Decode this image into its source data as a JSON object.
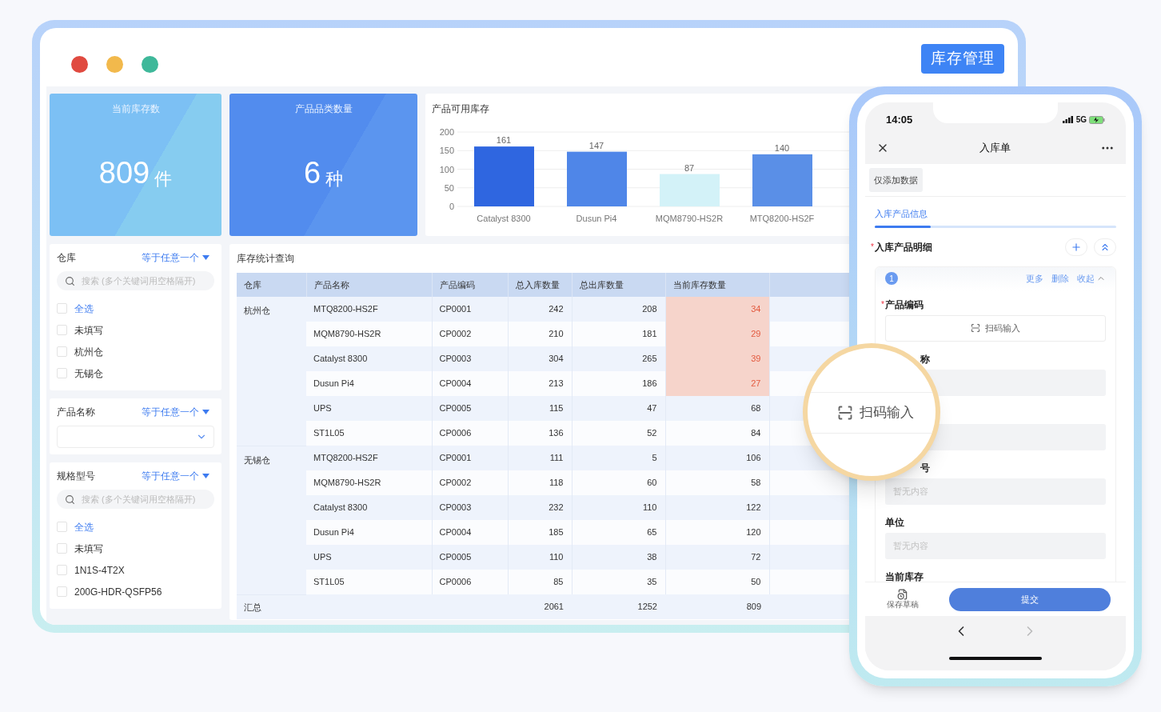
{
  "window": {
    "title_button": "库存管理"
  },
  "stats": [
    {
      "label": "当前库存数",
      "value": "809",
      "unit": "件",
      "kind": "light"
    },
    {
      "label": "产品品类数量",
      "value": "6",
      "unit": "种",
      "kind": "dark"
    }
  ],
  "chart": {
    "title": "产品可用库存",
    "chart_data": {
      "type": "bar",
      "categories": [
        "Catalyst 8300",
        "Dusun Pi4",
        "MQM8790-HS2R",
        "MTQ8200-HS2F"
      ],
      "values": [
        161,
        147,
        87,
        140
      ],
      "ylim": [
        0,
        200
      ],
      "yticks": [
        0,
        50,
        100,
        150,
        200
      ],
      "grid": true,
      "data_labels": true
    }
  },
  "filters": [
    {
      "label": "仓库",
      "operator": "等于任意一个",
      "kind": "checklist",
      "search_placeholder": "搜索 (多个关键词用空格隔开)",
      "options": [
        {
          "label": "全选",
          "kind": "all",
          "checked": false
        },
        {
          "label": "未填写",
          "kind": "value",
          "checked": false
        },
        {
          "label": "杭州仓",
          "kind": "value",
          "checked": false
        },
        {
          "label": "无锡仓",
          "kind": "value",
          "checked": false
        }
      ]
    },
    {
      "label": "产品名称",
      "operator": "等于任意一个",
      "kind": "select"
    },
    {
      "label": "规格型号",
      "operator": "等于任意一个",
      "kind": "checklist",
      "search_placeholder": "搜索 (多个关键词用空格隔开)",
      "options": [
        {
          "label": "全选",
          "kind": "all",
          "checked": false
        },
        {
          "label": "未填写",
          "kind": "value",
          "checked": false
        },
        {
          "label": "1N1S-4T2X",
          "kind": "value",
          "checked": false
        },
        {
          "label": "200G-HDR-QSFP56",
          "kind": "value",
          "checked": false
        }
      ]
    }
  ],
  "table": {
    "title": "库存统计查询",
    "columns": [
      "仓库",
      "产品名称",
      "产品编码",
      "总入库数量",
      "总出库数量",
      "当前库存数量"
    ],
    "groups": [
      {
        "warehouse": "杭州仓",
        "rows": [
          {
            "cells": [
              "MTQ8200-HS2F",
              "CP0001",
              "242",
              "208",
              "34"
            ],
            "alert": true
          },
          {
            "cells": [
              "MQM8790-HS2R",
              "CP0002",
              "210",
              "181",
              "29"
            ],
            "alert": true
          },
          {
            "cells": [
              "Catalyst 8300",
              "CP0003",
              "304",
              "265",
              "39"
            ],
            "alert": true
          },
          {
            "cells": [
              "Dusun Pi4",
              "CP0004",
              "213",
              "186",
              "27"
            ],
            "alert": true
          },
          {
            "cells": [
              "UPS",
              "CP0005",
              "115",
              "47",
              "68"
            ],
            "alert": false
          },
          {
            "cells": [
              "ST1L05",
              "CP0006",
              "136",
              "52",
              "84"
            ],
            "alert": false
          }
        ]
      },
      {
        "warehouse": "无锡仓",
        "rows": [
          {
            "cells": [
              "MTQ8200-HS2F",
              "CP0001",
              "111",
              "5",
              "106"
            ],
            "alert": false
          },
          {
            "cells": [
              "MQM8790-HS2R",
              "CP0002",
              "118",
              "60",
              "58"
            ],
            "alert": false
          },
          {
            "cells": [
              "Catalyst 8300",
              "CP0003",
              "232",
              "110",
              "122"
            ],
            "alert": false
          },
          {
            "cells": [
              "Dusun Pi4",
              "CP0004",
              "185",
              "65",
              "120"
            ],
            "alert": false
          },
          {
            "cells": [
              "UPS",
              "CP0005",
              "110",
              "38",
              "72"
            ],
            "alert": false
          },
          {
            "cells": [
              "ST1L05",
              "CP0006",
              "85",
              "35",
              "50"
            ],
            "alert": false
          }
        ]
      }
    ],
    "total": {
      "label": "汇总",
      "cells": [
        "2061",
        "1252",
        "809"
      ]
    }
  },
  "phone": {
    "status": {
      "time": "14:05",
      "network": "5G"
    },
    "title": "入库单",
    "tag": "仅添加数据",
    "tabs": [
      {
        "label": "入库产品信息",
        "selected": true
      }
    ],
    "section": {
      "title": "入库产品明细",
      "required_mark": "*"
    },
    "item": {
      "index": "1",
      "actions": [
        "更多",
        "删除",
        "收起"
      ]
    },
    "fields": [
      {
        "label": "产品编码",
        "required_mark": "*",
        "kind": "scan",
        "value": "扫码输入"
      },
      {
        "label": "称",
        "kind": "partial"
      },
      {
        "kind": "readonly"
      },
      {
        "label": "号",
        "kind": "partial",
        "placeholder": "暂无内容"
      },
      {
        "label": "单位",
        "kind": "readonly",
        "placeholder": "暂无内容"
      },
      {
        "label": "当前库存",
        "kind": "label"
      }
    ],
    "footer": {
      "draft": "保存草稿",
      "submit": "提交"
    },
    "nav": [
      {
        "kind": "back",
        "disabled": false
      },
      {
        "kind": "forward",
        "disabled": true
      }
    ]
  },
  "magnifier": {
    "label": "扫码输入"
  }
}
